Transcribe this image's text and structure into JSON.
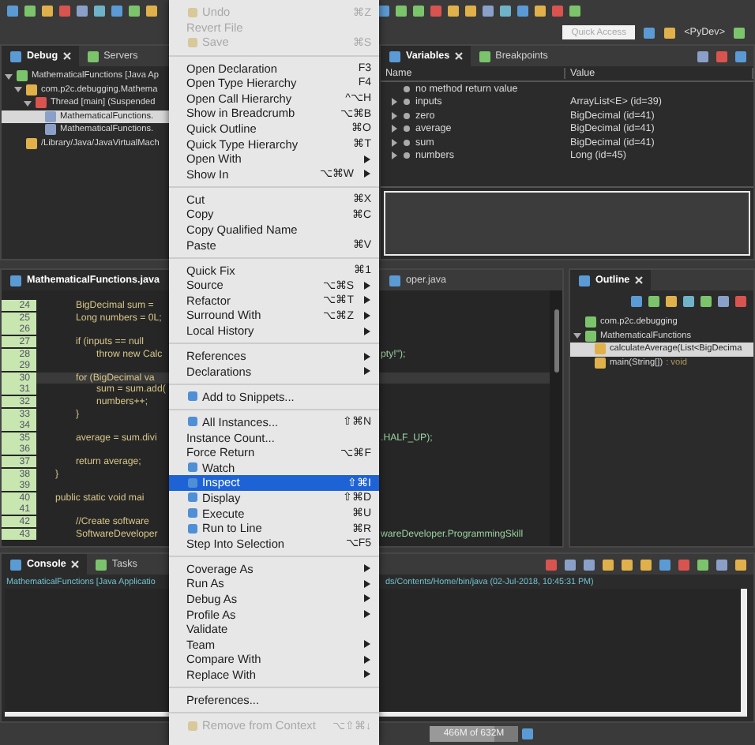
{
  "toolbar": {
    "quick_access": {
      "placeholder": "Quick Access"
    },
    "perspective": "<PyDev>"
  },
  "debug_panel": {
    "tabs": [
      {
        "label": "Debug",
        "selected": true
      },
      {
        "label": "Servers",
        "selected": false
      }
    ],
    "tree": [
      {
        "label": "MathematicalFunctions [Java Ap",
        "expanded": true,
        "selected": false,
        "children": [
          {
            "label": "com.p2c.debugging.Mathema",
            "expanded": true,
            "selected": false,
            "children": [
              {
                "label": "Thread [main] (Suspended",
                "expanded": true,
                "selected": false,
                "children": [
                  {
                    "label": "MathematicalFunctions.",
                    "selected": true
                  },
                  {
                    "label": "MathematicalFunctions.",
                    "selected": false
                  }
                ]
              }
            ]
          },
          {
            "label": "/Library/Java/JavaVirtualMach",
            "selected": false
          }
        ]
      }
    ]
  },
  "variables_panel": {
    "tabs": [
      {
        "label": "Variables",
        "selected": true
      },
      {
        "label": "Breakpoints",
        "selected": false
      }
    ],
    "columns": [
      "Name",
      "Value"
    ],
    "rows": [
      {
        "kind": "leaf",
        "name": "no method return value"
      },
      {
        "kind": "node",
        "name": "inputs",
        "value": "ArrayList<E>  (id=39)"
      },
      {
        "kind": "node",
        "name": "zero",
        "value": "BigDecimal  (id=41)"
      },
      {
        "kind": "node",
        "name": "average",
        "value": "BigDecimal  (id=41)"
      },
      {
        "kind": "node",
        "name": "sum",
        "value": "BigDecimal  (id=41)"
      },
      {
        "kind": "node",
        "name": "numbers",
        "value": "Long  (id=45)"
      }
    ]
  },
  "editor": {
    "tabs": [
      {
        "label": "MathematicalFunctions.java",
        "selected": true
      },
      {
        "label": "oper.java",
        "selected": false
      }
    ],
    "lines": [
      {
        "num": "24",
        "left": "\tBigDecimal sum = ",
        "current": false
      },
      {
        "num": "25",
        "left": "\tLong numbers = 0L;",
        "current": false
      },
      {
        "num": "26",
        "current": false
      },
      {
        "num": "27",
        "left": "\tif (inputs == null",
        "current": false
      },
      {
        "num": "28",
        "left": "\t\tthrow new Calc",
        "right": "pty!\");",
        "current": false
      },
      {
        "num": "29",
        "current": false
      },
      {
        "num": "30",
        "left": "\tfor (BigDecimal va",
        "current": true
      },
      {
        "num": "31",
        "left": "\t\tsum = sum.add(",
        "current": false
      },
      {
        "num": "32",
        "left": "\t\tnumbers++;",
        "current": false
      },
      {
        "num": "33",
        "left": "\t}",
        "current": false
      },
      {
        "num": "34",
        "current": false
      },
      {
        "num": "35",
        "left": "\taverage = sum.divi",
        "right": ".HALF_UP);",
        "current": false
      },
      {
        "num": "36",
        "current": false
      },
      {
        "num": "37",
        "left": "\treturn average;",
        "current": false
      },
      {
        "num": "38",
        "left": "}",
        "current": false
      },
      {
        "num": "39",
        "current": false
      },
      {
        "num": "40",
        "left": "public static void mai",
        "current": false
      },
      {
        "num": "41",
        "current": false
      },
      {
        "num": "42",
        "left": "\t//Create software",
        "current": false
      },
      {
        "num": "43",
        "left": "\tSoftwareDeveloper",
        "right": "wareDeveloper.ProgrammingSkill",
        "current": false
      }
    ]
  },
  "outline_panel": {
    "tabs": [
      {
        "label": "Outline",
        "selected": true
      }
    ],
    "tree": [
      {
        "label": "com.p2c.debugging",
        "selected": false
      },
      {
        "label": "MathematicalFunctions",
        "expanded": true,
        "selected": false,
        "children": [
          {
            "label": "calculateAverage(List<BigDecima",
            "selected": true
          },
          {
            "label": "main(String[])",
            "type": " : void",
            "selected": false
          }
        ]
      }
    ]
  },
  "console_panel": {
    "tabs": [
      {
        "label": "Console",
        "selected": true
      },
      {
        "label": "Tasks",
        "selected": false
      }
    ],
    "process_left": "MathematicalFunctions [Java Applicatio",
    "process_right": "ds/Contents/Home/bin/java (02-Jul-2018, 10:45:31 PM)"
  },
  "status_bar": {
    "memory": {
      "text": "466M of 632M",
      "level": 0.74
    }
  },
  "menu": {
    "items": [
      {
        "kind": "icon_item",
        "label": "Undo",
        "shortcut": "⌘Z",
        "submenu": false,
        "disabled": true,
        "selected": false
      },
      {
        "kind": "item",
        "label": "Revert File",
        "submenu": false,
        "disabled": true,
        "selected": false
      },
      {
        "kind": "icon_item",
        "label": "Save",
        "shortcut": "⌘S",
        "submenu": false,
        "disabled": true,
        "selected": false
      },
      {
        "kind": "separator"
      },
      {
        "kind": "item",
        "label": "Open Declaration",
        "shortcut": "F3",
        "submenu": false,
        "disabled": false,
        "selected": false
      },
      {
        "kind": "item",
        "label": "Open Type Hierarchy",
        "shortcut": "F4",
        "submenu": false,
        "disabled": false,
        "selected": false
      },
      {
        "kind": "item",
        "label": "Open Call Hierarchy",
        "shortcut": "^⌥H",
        "submenu": false,
        "disabled": false,
        "selected": false
      },
      {
        "kind": "item",
        "label": "Show in Breadcrumb",
        "shortcut": "⌥⌘B",
        "submenu": false,
        "disabled": false,
        "selected": false
      },
      {
        "kind": "item",
        "label": "Quick Outline",
        "shortcut": "⌘O",
        "submenu": false,
        "disabled": false,
        "selected": false
      },
      {
        "kind": "item",
        "label": "Quick Type Hierarchy",
        "shortcut": "⌘T",
        "submenu": false,
        "disabled": false,
        "selected": false
      },
      {
        "kind": "item",
        "label": "Open With",
        "submenu": true,
        "disabled": false,
        "selected": false
      },
      {
        "kind": "item",
        "label": "Show In",
        "shortcut": "⌥⌘W",
        "submenu": true,
        "disabled": false,
        "selected": false
      },
      {
        "kind": "separator"
      },
      {
        "kind": "item",
        "label": "Cut",
        "shortcut": "⌘X",
        "submenu": false,
        "disabled": false,
        "selected": false
      },
      {
        "kind": "item",
        "label": "Copy",
        "shortcut": "⌘C",
        "submenu": false,
        "disabled": false,
        "selected": false
      },
      {
        "kind": "item",
        "label": "Copy Qualified Name",
        "submenu": false,
        "disabled": false,
        "selected": false
      },
      {
        "kind": "item",
        "label": "Paste",
        "shortcut": "⌘V",
        "submenu": false,
        "disabled": false,
        "selected": false
      },
      {
        "kind": "separator"
      },
      {
        "kind": "item",
        "label": "Quick Fix",
        "shortcut": "⌘1",
        "submenu": false,
        "disabled": false,
        "selected": false
      },
      {
        "kind": "item",
        "label": "Source",
        "shortcut": "⌥⌘S",
        "submenu": true,
        "disabled": false,
        "selected": false
      },
      {
        "kind": "item",
        "label": "Refactor",
        "shortcut": "⌥⌘T",
        "submenu": true,
        "disabled": false,
        "selected": false
      },
      {
        "kind": "item",
        "label": "Surround With",
        "shortcut": "⌥⌘Z",
        "submenu": true,
        "disabled": false,
        "selected": false
      },
      {
        "kind": "item",
        "label": "Local History",
        "submenu": true,
        "disabled": false,
        "selected": false
      },
      {
        "kind": "separator"
      },
      {
        "kind": "item",
        "label": "References",
        "submenu": true,
        "disabled": false,
        "selected": false
      },
      {
        "kind": "item",
        "label": "Declarations",
        "submenu": true,
        "disabled": false,
        "selected": false
      },
      {
        "kind": "separator"
      },
      {
        "kind": "icon_item",
        "label": "Add to Snippets...",
        "submenu": false,
        "disabled": false,
        "selected": false
      },
      {
        "kind": "separator"
      },
      {
        "kind": "icon_item",
        "label": "All Instances...",
        "shortcut": "⇧⌘N",
        "submenu": false,
        "disabled": false,
        "selected": false
      },
      {
        "kind": "item",
        "label": "Instance Count...",
        "submenu": false,
        "disabled": false,
        "selected": false
      },
      {
        "kind": "item",
        "label": "Force Return",
        "shortcut": "⌥⌘F",
        "submenu": false,
        "disabled": false,
        "selected": false
      },
      {
        "kind": "icon_item",
        "label": "Watch",
        "submenu": false,
        "disabled": false,
        "selected": false
      },
      {
        "kind": "icon_item",
        "label": "Inspect",
        "shortcut": "⇧⌘I",
        "submenu": false,
        "disabled": false,
        "selected": true
      },
      {
        "kind": "icon_item",
        "label": "Display",
        "shortcut": "⇧⌘D",
        "submenu": false,
        "disabled": false,
        "selected": false
      },
      {
        "kind": "icon_item",
        "label": "Execute",
        "shortcut": "⌘U",
        "submenu": false,
        "disabled": false,
        "selected": false
      },
      {
        "kind": "icon_item",
        "label": "Run to Line",
        "shortcut": "⌘R",
        "submenu": false,
        "disabled": false,
        "selected": false
      },
      {
        "kind": "item",
        "label": "Step Into Selection",
        "shortcut": "⌥F5",
        "submenu": false,
        "disabled": false,
        "selected": false
      },
      {
        "kind": "separator"
      },
      {
        "kind": "item",
        "label": "Coverage As",
        "submenu": true,
        "disabled": false,
        "selected": false
      },
      {
        "kind": "item",
        "label": "Run As",
        "submenu": true,
        "disabled": false,
        "selected": false
      },
      {
        "kind": "item",
        "label": "Debug As",
        "submenu": true,
        "disabled": false,
        "selected": false
      },
      {
        "kind": "item",
        "label": "Profile As",
        "submenu": true,
        "disabled": false,
        "selected": false
      },
      {
        "kind": "item",
        "label": "Validate",
        "submenu": false,
        "disabled": false,
        "selected": false
      },
      {
        "kind": "item",
        "label": "Team",
        "submenu": true,
        "disabled": false,
        "selected": false
      },
      {
        "kind": "item",
        "label": "Compare With",
        "submenu": true,
        "disabled": false,
        "selected": false
      },
      {
        "kind": "item",
        "label": "Replace With",
        "submenu": true,
        "disabled": false,
        "selected": false
      },
      {
        "kind": "separator"
      },
      {
        "kind": "item",
        "label": "Preferences...",
        "submenu": false,
        "disabled": false,
        "selected": false
      },
      {
        "kind": "separator"
      },
      {
        "kind": "icon_item",
        "label": "Remove from Context",
        "shortcut": "⌥⇧⌘↓",
        "submenu": false,
        "disabled": true,
        "selected": false
      }
    ]
  }
}
